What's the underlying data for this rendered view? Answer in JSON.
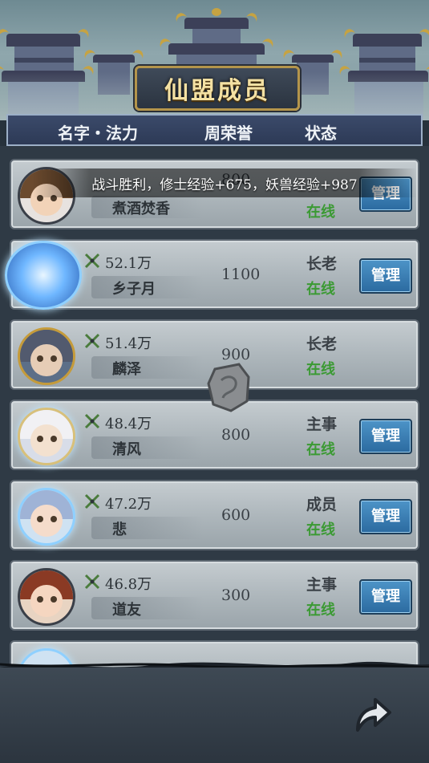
{
  "title": "仙盟成员",
  "columns": {
    "name_power": "名字・法力",
    "weekly_honor": "周荣誉",
    "status": "状态"
  },
  "notification": "战斗胜利，修士经验+675，妖兽经验+987",
  "members": [
    {
      "power": "",
      "name": "煮酒焚香",
      "honor": "800",
      "rank": "",
      "online": "在线",
      "manage": "管理",
      "avatar": "avatar-white-hair-girl"
    },
    {
      "power": "52.1万",
      "name": "乡子月",
      "honor": "1100",
      "rank": "长老",
      "online": "在线",
      "manage": "管理",
      "avatar": "avatar-blue-spirit-orb"
    },
    {
      "power": "51.4万",
      "name": "麟泽",
      "honor": "900",
      "rank": "长老",
      "online": "在线",
      "manage": "",
      "avatar": "avatar-grey-hair-man"
    },
    {
      "power": "48.4万",
      "name": "清风",
      "honor": "800",
      "rank": "主事",
      "online": "在线",
      "manage": "管理",
      "avatar": "avatar-crowned-elder"
    },
    {
      "power": "47.2万",
      "name": "悲",
      "honor": "600",
      "rank": "成员",
      "online": "在线",
      "manage": "管理",
      "avatar": "avatar-crystal-crown-girl"
    },
    {
      "power": "46.8万",
      "name": "道友",
      "honor": "300",
      "rank": "主事",
      "online": "在线",
      "manage": "管理",
      "avatar": "avatar-red-hair-girl"
    }
  ],
  "colors": {
    "online": "#3b9a33",
    "manage_button": "#3d82b8",
    "title_text": "#f4e1a3"
  },
  "icons": {
    "power": "crossed-sword-icon",
    "back": "back-arrow-icon",
    "center": "stone-rune-icon"
  }
}
